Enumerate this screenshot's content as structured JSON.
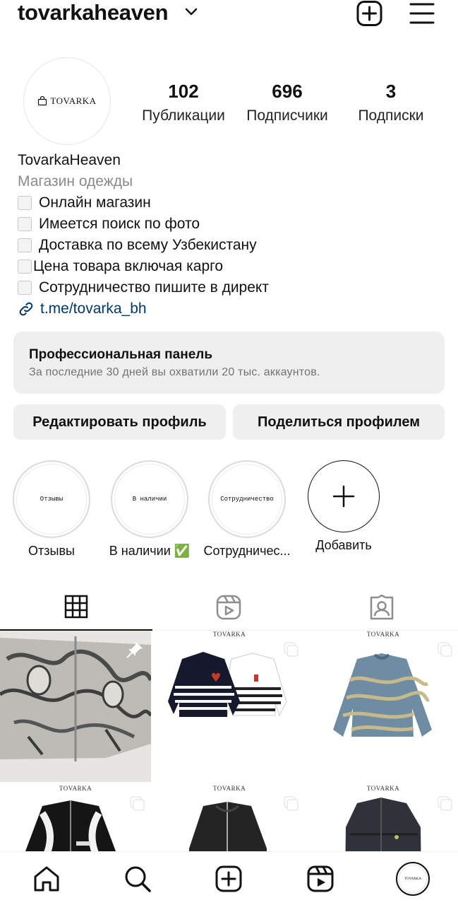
{
  "header": {
    "username": "tovarkaheaven",
    "icons": {
      "chevron": "chevron-down-icon",
      "create": "plus-square-icon",
      "menu": "hamburger-menu-icon"
    }
  },
  "profile": {
    "avatar_text": "TOVARKA",
    "stats": {
      "posts": {
        "value": "102",
        "label": "Публикации"
      },
      "followers": {
        "value": "696",
        "label": "Подписчики"
      },
      "following": {
        "value": "3",
        "label": "Подписки"
      }
    }
  },
  "bio": {
    "name": "TovarkaHeaven",
    "category": "Магазин одежды",
    "lines": [
      "Онлайн магазин",
      "Имеется поиск по фото",
      "Доставка по всему Узбекистану",
      "Цена товара включая карго",
      "Сотрудничество пишите в директ"
    ],
    "link": "t.me/tovarka_bh"
  },
  "pro_panel": {
    "title": "Профессиональная панель",
    "subtitle": "За последние 30 дней вы охватили 20 тыс. аккаунтов."
  },
  "buttons": {
    "edit": "Редактировать профиль",
    "share": "Поделиться профилем"
  },
  "highlights": [
    {
      "cover": "Отзывы",
      "label": "Отзывы"
    },
    {
      "cover": "В наличии",
      "label": "В наличии ✅"
    },
    {
      "cover": "Сотрудничество",
      "label": "Сотрудничес..."
    },
    {
      "cover": "",
      "label": "Добавить"
    }
  ],
  "tabs": [
    "grid-icon",
    "reels-icon",
    "tagged-icon"
  ],
  "posts": {
    "brand": "TOVARKA"
  },
  "nav": [
    "home-icon",
    "search-icon",
    "create-icon",
    "reels-icon",
    "profile-avatar"
  ]
}
